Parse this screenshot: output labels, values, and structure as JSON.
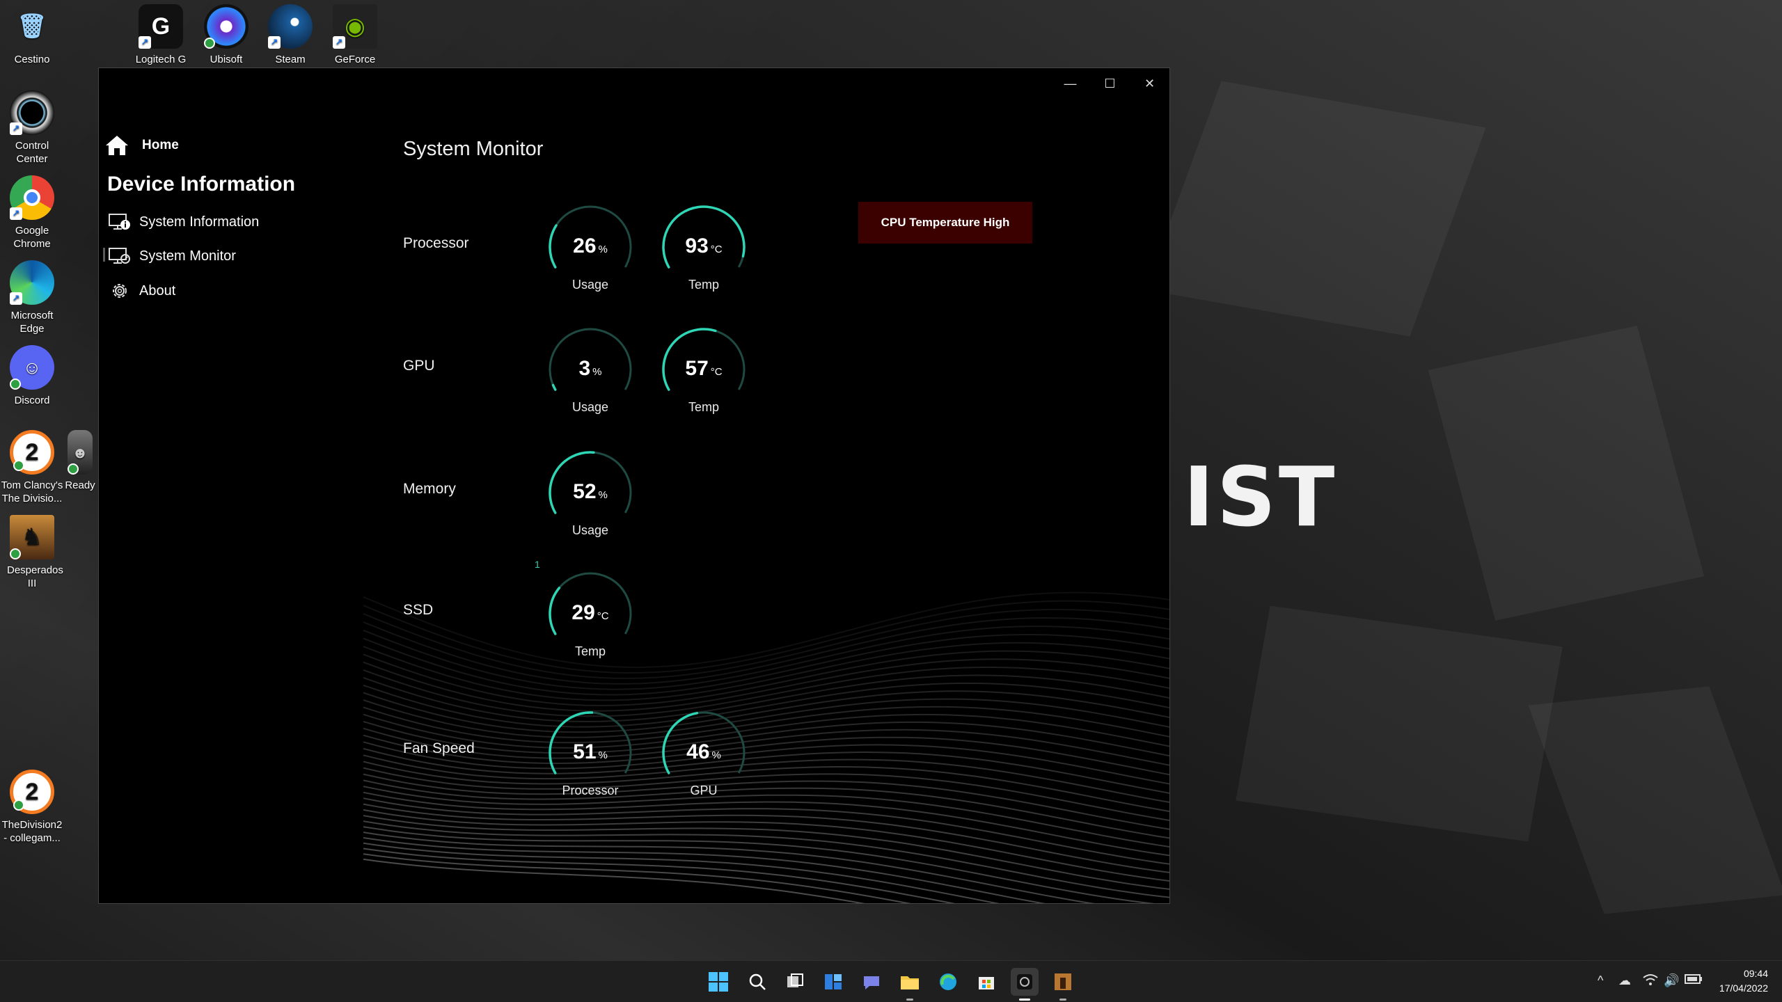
{
  "desktop": {
    "wallpaper_text": "IST",
    "icons": [
      {
        "label": "Cestino",
        "icon": "recycle-bin-icon"
      },
      {
        "label": "Logitech G HUB",
        "icon": "logitech-icon"
      },
      {
        "label": "Ubisoft Connect",
        "icon": "ubisoft-icon"
      },
      {
        "label": "Steam",
        "icon": "steam-icon"
      },
      {
        "label": "GeForce Experience",
        "icon": "nvidia-icon"
      },
      {
        "label": "Control Center",
        "icon": "control-center-icon"
      },
      {
        "label": "Google Chrome",
        "icon": "chrome-icon"
      },
      {
        "label": "Microsoft Edge",
        "icon": "edge-icon"
      },
      {
        "label": "Discord",
        "icon": "discord-icon"
      },
      {
        "label": "Tom Clancy's The Divisio...",
        "icon": "division-icon"
      },
      {
        "label": "Ready",
        "icon": "ready-game-icon"
      },
      {
        "label": "Desperados III",
        "icon": "desperados-icon"
      },
      {
        "label": "TheDivision2 - collegam...",
        "icon": "division-icon"
      }
    ]
  },
  "window": {
    "controls": {
      "minimize": "—",
      "maximize": "☐",
      "close": "✕"
    },
    "nav": {
      "home": "Home",
      "section_title": "Device Information",
      "items": [
        "System Information",
        "System Monitor",
        "About"
      ]
    },
    "page_title": "System Monitor",
    "alert": "CPU Temperature High",
    "stray_mark": "1",
    "rows": {
      "processor": {
        "label": "Processor",
        "gauges": [
          {
            "value": "26",
            "unit": "%",
            "caption": "Usage",
            "fraction": 0.26
          },
          {
            "value": "93",
            "unit": "°C",
            "caption": "Temp",
            "fraction": 0.93
          }
        ]
      },
      "gpu": {
        "label": "GPU",
        "gauges": [
          {
            "value": "3",
            "unit": "%",
            "caption": "Usage",
            "fraction": 0.03
          },
          {
            "value": "57",
            "unit": "°C",
            "caption": "Temp",
            "fraction": 0.57
          }
        ]
      },
      "memory": {
        "label": "Memory",
        "gauges": [
          {
            "value": "52",
            "unit": "%",
            "caption": "Usage",
            "fraction": 0.52
          }
        ]
      },
      "ssd": {
        "label": "SSD",
        "gauges": [
          {
            "value": "29",
            "unit": "°C",
            "caption": "Temp",
            "fraction": 0.29
          }
        ]
      },
      "fan": {
        "label": "Fan Speed",
        "gauges": [
          {
            "value": "51",
            "unit": "%",
            "caption": "Processor",
            "fraction": 0.51
          },
          {
            "value": "46",
            "unit": "%",
            "caption": "GPU",
            "fraction": 0.46
          }
        ]
      }
    },
    "colors": {
      "accent": "#2ed6b5",
      "track": "#1f4a42",
      "alert_bg": "#3b0000"
    }
  },
  "taskbar": {
    "apps": [
      "windows-start-icon",
      "search-icon",
      "task-view-icon",
      "widgets-icon",
      "teams-chat-icon",
      "file-explorer-icon",
      "edge-icon",
      "store-icon",
      "system-monitor-app-icon",
      "desperados-icon"
    ],
    "clock": {
      "time": "09:44",
      "date": "17/04/2022"
    }
  }
}
